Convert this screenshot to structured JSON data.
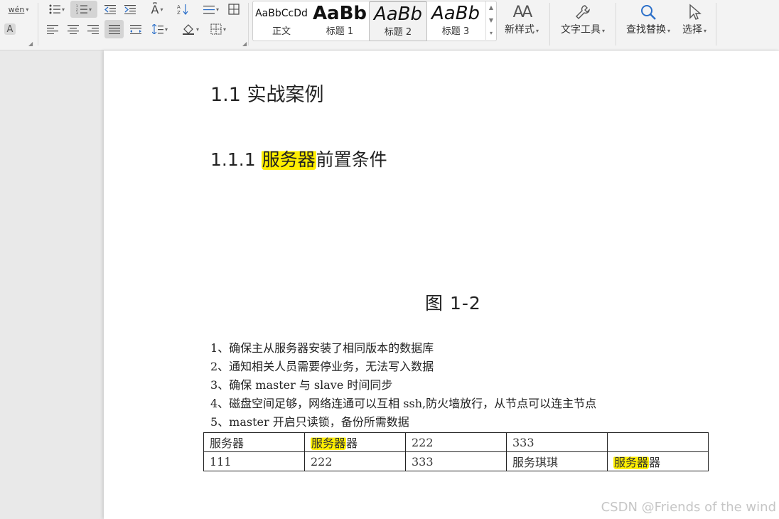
{
  "ribbon": {
    "phonetic_label": "wén",
    "font_frame_label": "A",
    "styles": [
      {
        "preview": "AaBbCcDd",
        "label": "正文"
      },
      {
        "preview": "AaBb",
        "label": "标题 1"
      },
      {
        "preview": "AaBb",
        "label": "标题 2"
      },
      {
        "preview": "AaBb",
        "label": "标题 3"
      }
    ],
    "new_style": "新样式",
    "text_tools": "文字工具",
    "find_replace": "查找替换",
    "select": "选择"
  },
  "document": {
    "heading1": "1.1  实战案例",
    "heading2_prefix": "1.1.1 ",
    "heading2_highlight": "服务器",
    "heading2_suffix": "前置条件",
    "figure_caption": "图 1-2",
    "list": [
      "1、确保主从服务器安装了相同版本的数据库",
      "2、通知相关人员需要停业务，无法写入数据",
      "3、确保 master 与 slave 时间同步",
      "4、磁盘空间足够，网络连通可以互相 ssh,防火墙放行，从节点可以连主节点",
      "5、master 开启只读锁，备份所需数据"
    ],
    "table": {
      "r1c1": "服务器",
      "r1c2_hl": "服务器",
      "r1c2_rest": "器",
      "r1c3": "222",
      "r1c4": "333",
      "r1c5": "",
      "r2c1": "111",
      "r2c2": "222",
      "r2c3": "333",
      "r2c4": "服务琪琪",
      "r2c5_hl": "服务器",
      "r2c5_rest": "器"
    },
    "highlight_color": "#ffee00"
  },
  "watermark": "CSDN @Friends of the wind"
}
